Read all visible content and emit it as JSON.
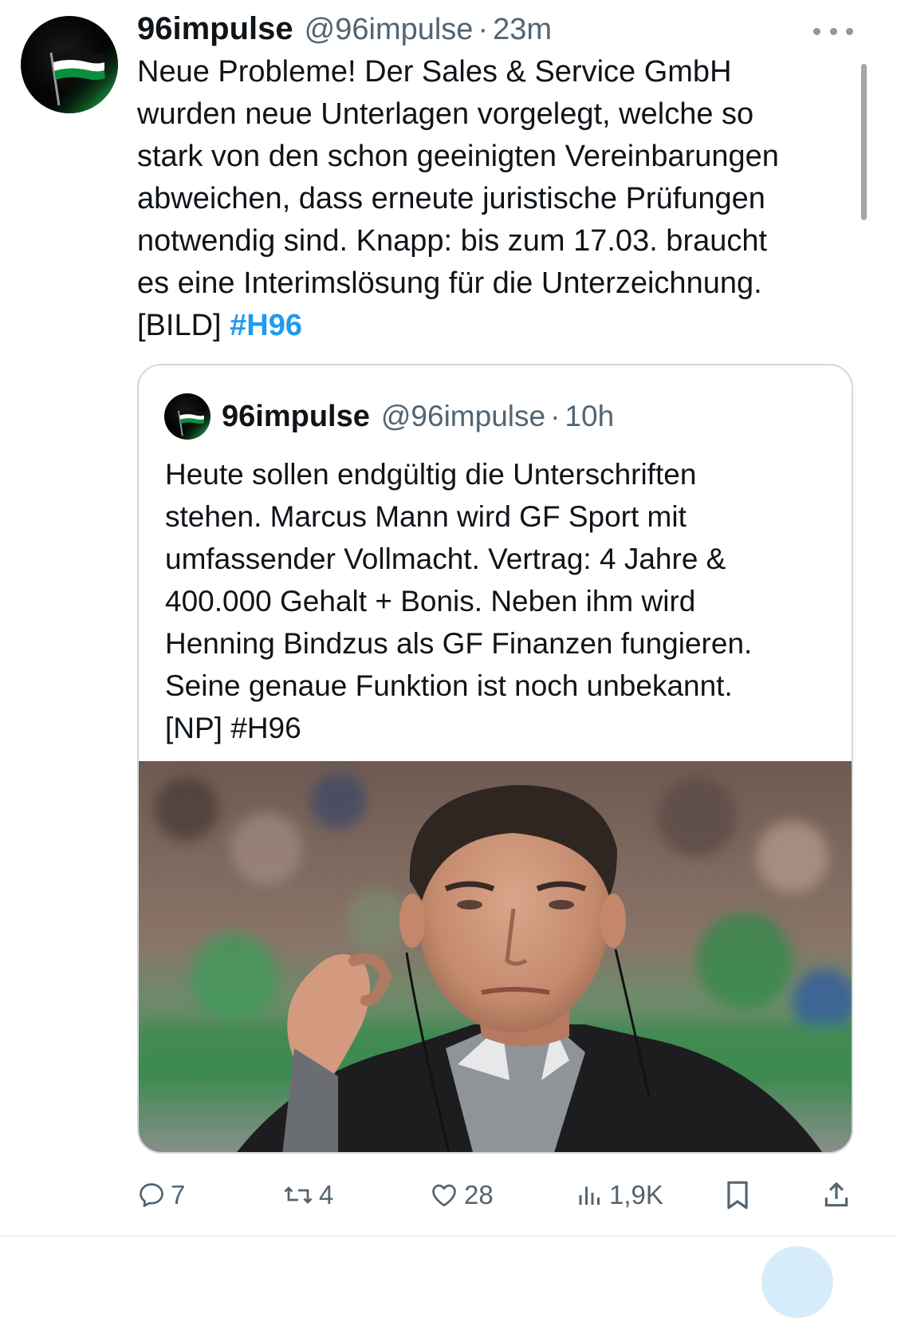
{
  "tweet": {
    "author_name": "96impulse",
    "author_handle": "@96impulse",
    "separator": "·",
    "time": "23m",
    "text_lines": [
      "Neue Probleme! Der Sales & Service GmbH",
      "wurden neue Unterlagen vorgelegt, welche so",
      "stark von den schon geeinigten Vereinbarungen",
      "abweichen, dass erneute juristische Prüfungen",
      "notwendig sind. Knapp: bis zum 17.03. braucht",
      "es eine Interimslösung für die Unterzeichnung."
    ],
    "last_line_prefix": "[BILD] ",
    "hashtag": "#H96",
    "icons": {
      "more": "more-icon",
      "avatar": "flag-avatar"
    }
  },
  "quote": {
    "author_name": "96impulse",
    "author_handle": "@96impulse",
    "separator": "·",
    "time": "10h",
    "text_lines": [
      "Heute sollen endgültig die Unterschriften",
      "stehen. Marcus Mann wird GF Sport mit",
      "umfassender Vollmacht. Vertrag: 4 Jahre &",
      "400.000 Gehalt + Bonis. Neben ihm wird",
      "Henning Bindzus als GF Finanzen fungieren.",
      "Seine genaue Funktion ist noch unbekannt.",
      "[NP] #H96"
    ]
  },
  "actions": {
    "reply_count": "7",
    "retweet_count": "4",
    "like_count": "28",
    "views_count": "1,9K"
  },
  "colors": {
    "text": "#0f1419",
    "secondary": "#536471",
    "link": "#1d9bf0",
    "border": "#cfd9de"
  }
}
